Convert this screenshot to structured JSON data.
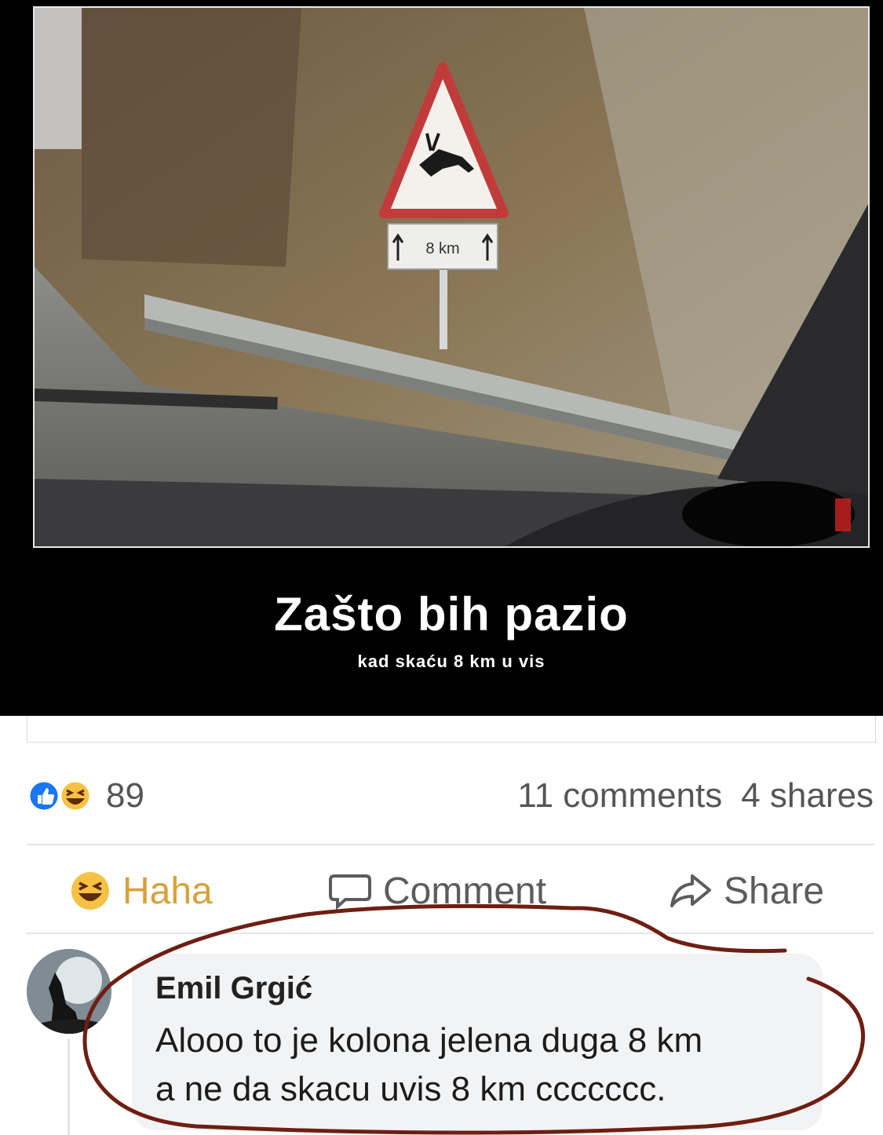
{
  "poster": {
    "title": "Zašto bih pazio",
    "subtitle": "kad skaću 8 km u vis",
    "sign_text": "8 km"
  },
  "post": {
    "reactions": {
      "icons": [
        "like-icon",
        "haha-icon"
      ],
      "count": "89"
    },
    "comments_count": "11 comments",
    "shares_count": "4 shares",
    "actions": {
      "reaction_label": "Haha",
      "comment_label": "Comment",
      "share_label": "Share"
    }
  },
  "comment": {
    "author": "Emil Grgić",
    "line1": "Alooo to je kolona jelena duga 8 km",
    "line2": "a ne da skacu uvis 8 km ccccccc."
  },
  "colors": {
    "like_blue": "#1877f2",
    "haha_yellow": "#f7c145",
    "annotation_red": "#6e1e12"
  }
}
